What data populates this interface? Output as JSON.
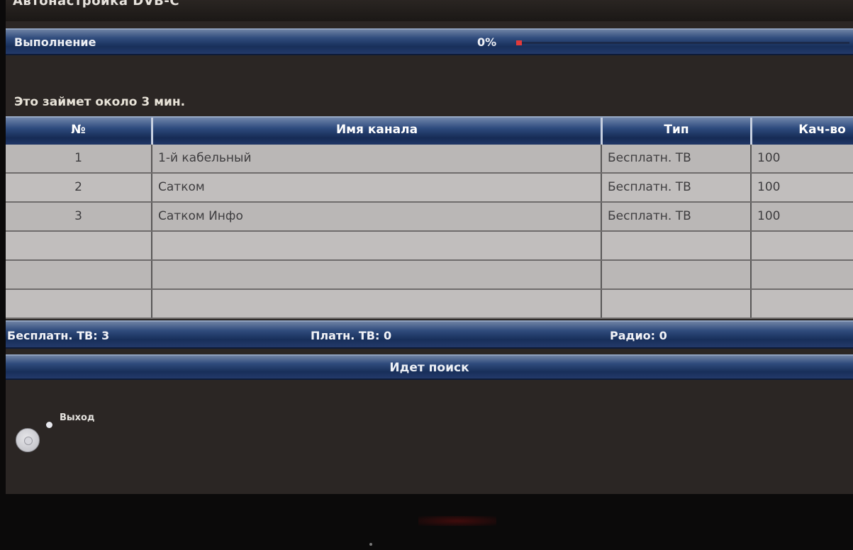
{
  "window": {
    "title": "Автонастройка DVB-C"
  },
  "progress": {
    "label": "Выполнение",
    "percent_text": "0%",
    "fraction": 0.0
  },
  "hint": "Это займет около 3 мин.",
  "table": {
    "columns": [
      "№",
      "Имя канала",
      "Тип",
      "Кач-во"
    ],
    "rows": [
      [
        "1",
        "1-й кабельный",
        "Бесплатн. ТВ",
        "100"
      ],
      [
        "2",
        "Сатком",
        "Бесплатн. ТВ",
        "100"
      ],
      [
        "3",
        "Сатком Инфо",
        "Бесплатн. ТВ",
        "100"
      ],
      [
        "",
        "",
        "",
        ""
      ],
      [
        "",
        "",
        "",
        ""
      ],
      [
        "",
        "",
        "",
        ""
      ]
    ]
  },
  "counts": {
    "free_tv": "Бесплатн. ТВ: 3",
    "pay_tv": "Платн. ТВ: 0",
    "radio": "Радио: 0"
  },
  "status": "Идет поиск",
  "footer": {
    "exit_label": "Выход",
    "exit_icon": "remote-control-icon"
  },
  "colors": {
    "background": "#2b2624",
    "bar_blue": "#2f4b7c",
    "row_gray": "#bab7b6",
    "progress_red": "#e23a3a"
  }
}
